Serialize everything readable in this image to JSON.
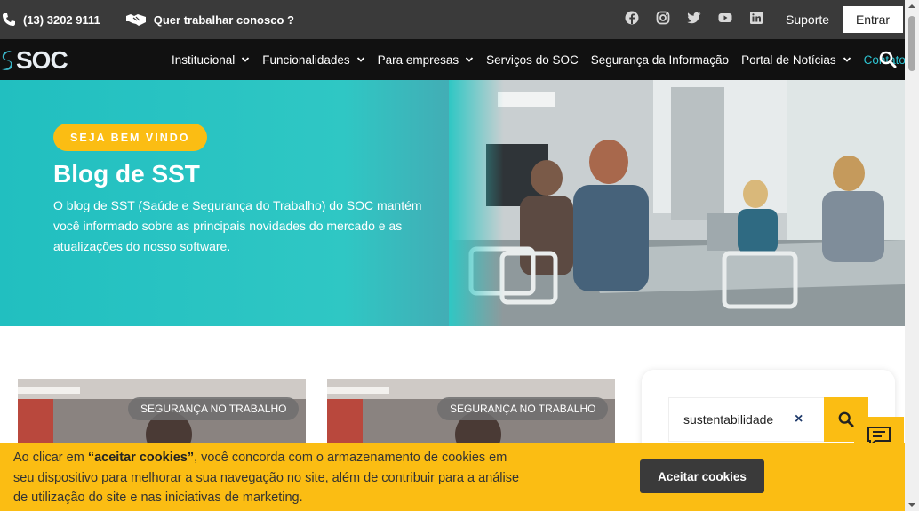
{
  "topbar": {
    "phone": "(13) 3202 9111",
    "work_with_us": "Quer trabalhar conosco ?",
    "social_icons": [
      "facebook-icon",
      "instagram-icon",
      "twitter-icon",
      "youtube-icon",
      "linkedin-icon"
    ],
    "support_label": "Suporte",
    "login_label": "Entrar"
  },
  "nav": {
    "logo_text": "SOC",
    "items": [
      {
        "label": "Institucional",
        "has_dropdown": true
      },
      {
        "label": "Funcionalidades",
        "has_dropdown": true
      },
      {
        "label": "Para empresas",
        "has_dropdown": true
      },
      {
        "label": "Serviços do SOC",
        "has_dropdown": false
      },
      {
        "label": "Segurança da Informação",
        "has_dropdown": false
      },
      {
        "label": "Portal de Notícias",
        "has_dropdown": true
      },
      {
        "label": "Contato",
        "has_dropdown": true,
        "active": true
      }
    ]
  },
  "hero": {
    "badge": "SEJA BEM VINDO",
    "title": "Blog de SST",
    "description": "O blog de SST (Saúde e Segurança do Trabalho) do SOC mantém você informado sobre as principais novidades do mercado e as atualizações do nosso software."
  },
  "cards": [
    {
      "tag": "SEGURANÇA NO TRABALHO"
    },
    {
      "tag": "SEGURANÇA NO TRABALHO"
    }
  ],
  "sidebar": {
    "search_value": "sustentabilidade",
    "clear_icon": "×"
  },
  "cookie": {
    "text_before": "Ao clicar em ",
    "text_bold": "“aceitar cookies”",
    "text_after": ", você concorda com o armazenamento de cookies em seu dispositivo para melhorar a sua navegação no site, além de contribuir para a análise de utilização do site e nas iniciativas de marketing.",
    "button_label": "Aceitar cookies"
  },
  "colors": {
    "accent": "#fbbd13",
    "teal": "#21bfc0",
    "nav_active": "#2ec4d2",
    "topbar_bg": "#3a3a3a",
    "nav_bg": "#111111"
  }
}
